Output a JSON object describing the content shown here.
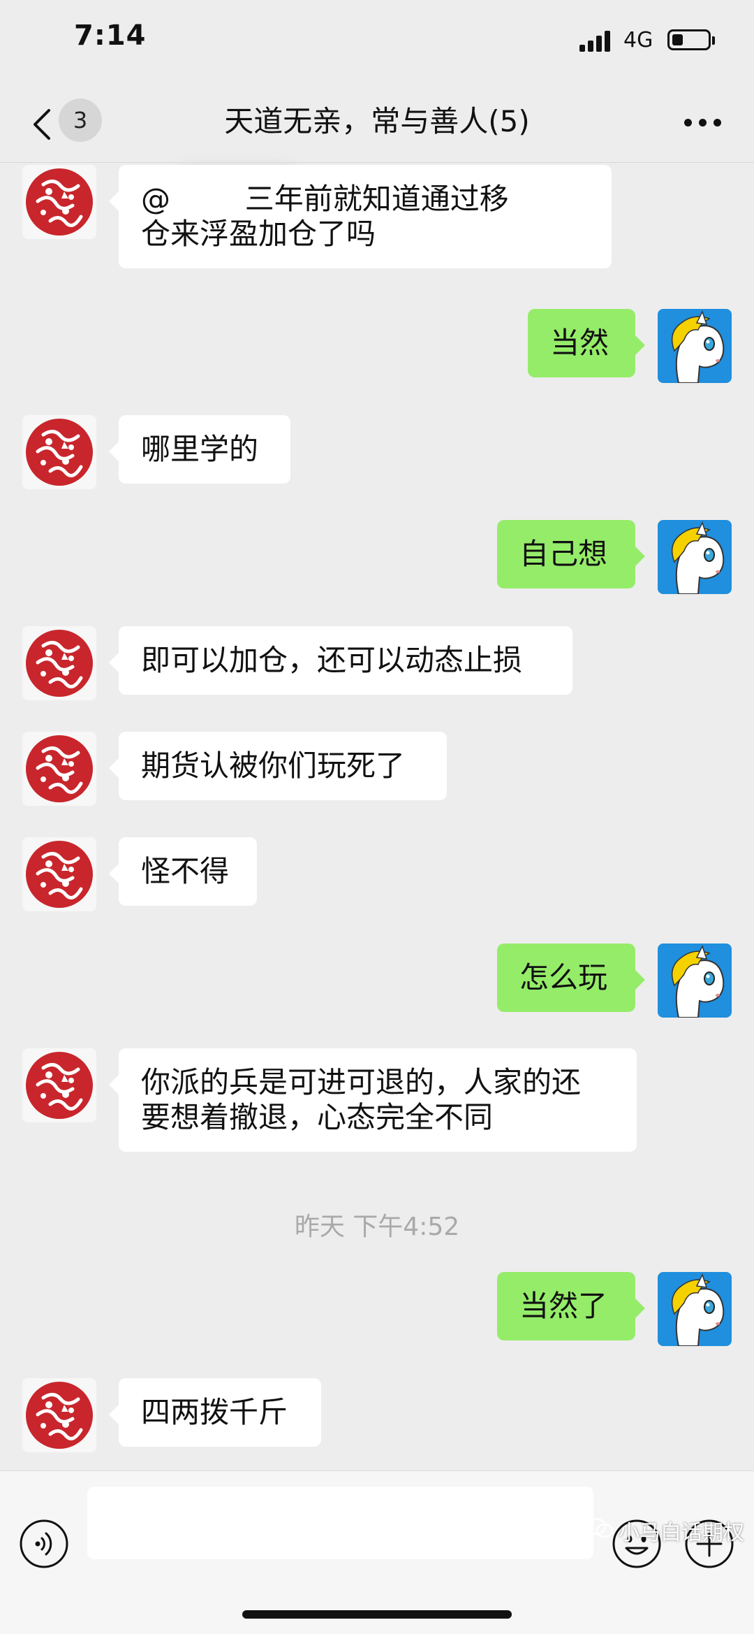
{
  "status_bar": {
    "time": "7:14",
    "network": "4G",
    "battery_level": 0.3
  },
  "header": {
    "back_icon": "chevron-left-icon",
    "unread_count": "3",
    "title": "天道无亲，常与善人(5)",
    "more_icon": "ellipsis-icon"
  },
  "messages": [
    {
      "side": "left",
      "text": "@        三年前就知道通过移\n仓来浮盈加仓了吗"
    },
    {
      "side": "right",
      "text": "当然"
    },
    {
      "side": "left",
      "text": "哪里学的"
    },
    {
      "side": "right",
      "text": "自己想"
    },
    {
      "side": "left",
      "text": "即可以加仓，还可以动态止损"
    },
    {
      "side": "left",
      "text": "期货认被你们玩死了"
    },
    {
      "side": "left",
      "text": "怪不得"
    },
    {
      "side": "right",
      "text": "怎么玩"
    },
    {
      "side": "left",
      "text": "你派的兵是可进可退的，人家的还\n要想着撤退，心态完全不同"
    },
    {
      "side": "right",
      "text": "当然了"
    },
    {
      "side": "left",
      "text": "四两拨千斤"
    }
  ],
  "timestamp": "昨天 下午4:52",
  "input_bar": {
    "voice_icon": "voice-icon",
    "emoji_icon": "emoji-icon",
    "plus_icon": "plus-icon",
    "message_value": ""
  },
  "watermark": "小马白话期权",
  "colors": {
    "background": "#ededed",
    "sent_bubble": "#95ec69",
    "received_bubble": "#ffffff",
    "avatar_red": "#c8262c",
    "avatar_blue": "#1f8fde",
    "horse_mane": "#f5d100"
  }
}
